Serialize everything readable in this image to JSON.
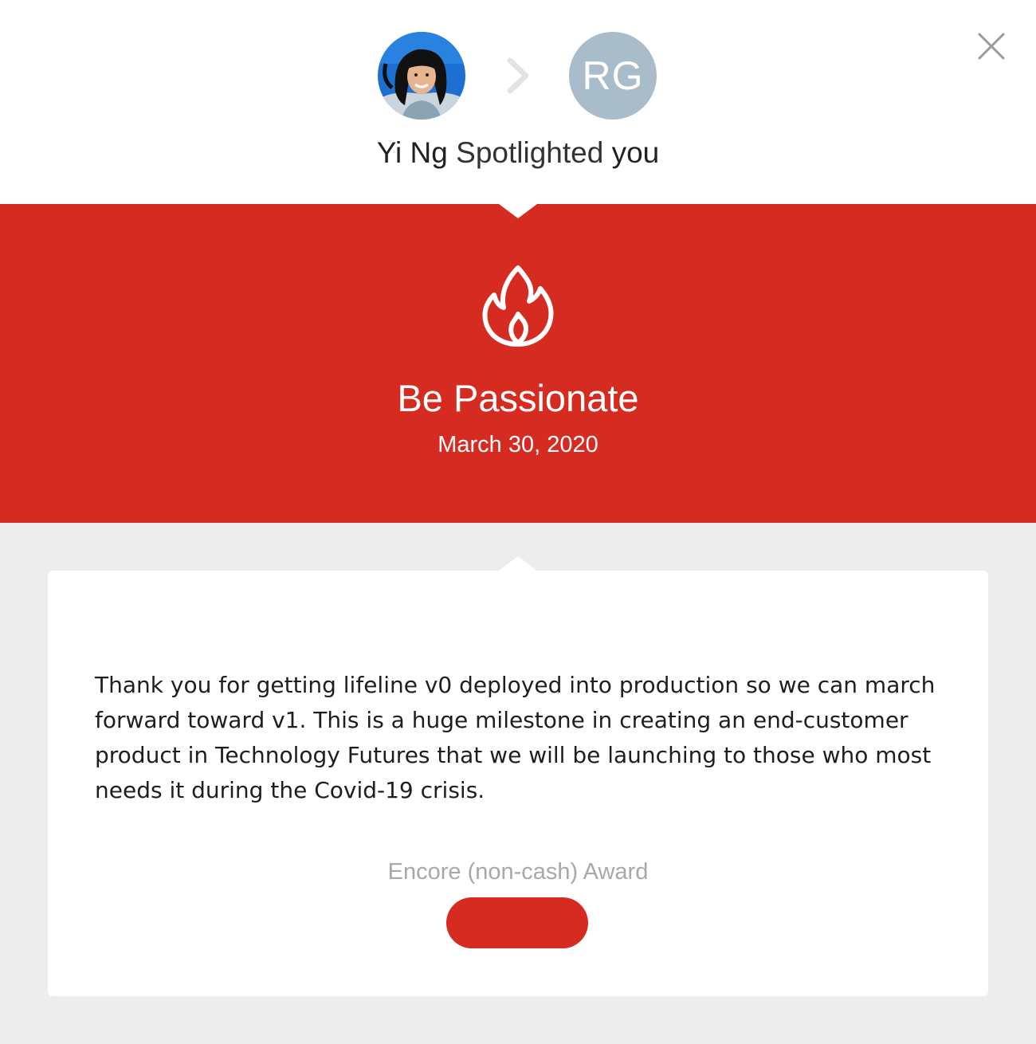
{
  "header": {
    "sender_name": "Yi Ng",
    "action_text": "Spotlighted",
    "recipient_text": "you",
    "recipient_initials": "RG",
    "icons": [
      "avatar-photo",
      "chevron-right-icon",
      "close-icon"
    ]
  },
  "award": {
    "title": "Be Passionate",
    "date": "March 30, 2020",
    "icon": "flame-icon"
  },
  "message": {
    "text": "Thank you for getting lifeline v0 deployed into production so we can march forward toward v1. This is a huge milestone in creating an end-customer product in Technology Futures that we will be launching to those who most needs it during the Covid-19 crisis."
  },
  "award_details": {
    "type_label": "Encore (non-cash) Award",
    "button_label": ""
  },
  "colors": {
    "accent": "#d52b20",
    "initials_avatar": "#a9bcc9",
    "page_background": "#ededed",
    "muted_text": "#a8a8a8"
  }
}
